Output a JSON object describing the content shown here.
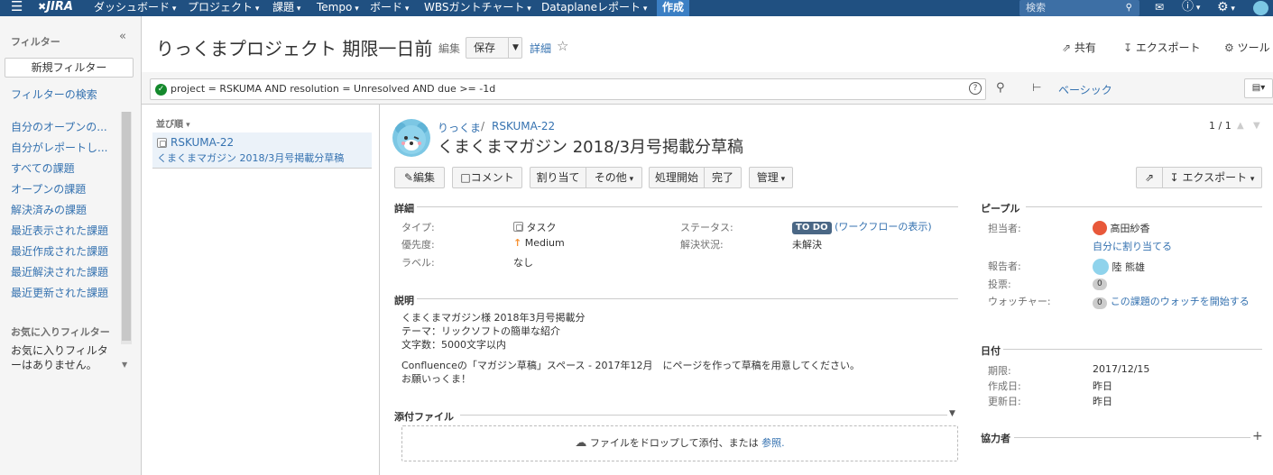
{
  "topbar": {
    "logo": "JIRA",
    "nav": [
      "ダッシュボード",
      "プロジェクト",
      "課題",
      "Tempo",
      "ボード",
      "WBSガントチャート",
      "Dataplaneレポート"
    ],
    "create_label": "作成",
    "search_placeholder": "検索"
  },
  "sidebar": {
    "heading": "フィルター",
    "new_filter_label": "新規フィルター",
    "search_filters_link": "フィルターの検索",
    "links": [
      "自分のオープンの...",
      "自分がレポートし...",
      "すべての課題",
      "オープンの課題",
      "解決済みの課題",
      "最近表示された課題",
      "最近作成された課題",
      "最近解決された課題",
      "最近更新された課題"
    ],
    "favorites_heading": "お気に入りフィルター",
    "favorites_empty": "お気に入りフィルターはありません。"
  },
  "header": {
    "title": "りっくまプロジェクト 期限一日前",
    "edit_label": "編集",
    "save_label": "保存",
    "details_label": "詳細",
    "share_label": "共有",
    "export_label": "エクスポート",
    "tools_label": "ツール"
  },
  "search": {
    "jql": "project = RSKUMA AND resolution = Unresolved AND due >= -1d",
    "basic_label": "ベーシック"
  },
  "list": {
    "order_label": "並び順",
    "items": [
      {
        "key": "RSKUMA-22",
        "summary": "くまくまマガジン 2018/3月号掲載分草稿"
      }
    ]
  },
  "issue": {
    "breadcrumb_project": "りっくま",
    "breadcrumb_sep": "/",
    "key": "RSKUMA-22",
    "title": "くまくまマガジン 2018/3月号掲載分草稿",
    "pager": "1 / 1",
    "actions": {
      "edit": "編集",
      "comment": "コメント",
      "assign": "割り当て",
      "more": "その他",
      "start": "処理開始",
      "done": "完了",
      "admin": "管理",
      "export": "エクスポート"
    },
    "details": {
      "heading": "詳細",
      "type_label": "タイプ:",
      "type_value": "タスク",
      "priority_label": "優先度:",
      "priority_value": "Medium",
      "labels_label": "ラベル:",
      "labels_value": "なし",
      "status_label": "ステータス:",
      "status_value": "TO DO",
      "workflow_link": "(ワークフローの表示)",
      "resolution_label": "解決状況:",
      "resolution_value": "未解決"
    },
    "description": {
      "heading": "説明",
      "lines": [
        "くまくまマガジン様 2018年3月号掲載分",
        "テーマ：リックソフトの簡単な紹介",
        "文字数：5000文字以内"
      ],
      "confluence_line": "Confluenceの「マガジン草稿」スペース - 2017年12月　にページを作って草稿を用意してください。",
      "closing_line": "お願いっくま！"
    },
    "attachments": {
      "heading": "添付ファイル",
      "drop_text": "ファイルをドロップして添付、または",
      "browse_link": "参照."
    },
    "people": {
      "heading": "ピープル",
      "assignee_label": "担当者:",
      "assignee_value": "高田紗香",
      "assign_to_me": "自分に割り当てる",
      "reporter_label": "報告者:",
      "reporter_value": "陸 熊雄",
      "votes_label": "投票:",
      "votes_value": "0",
      "watchers_label": "ウォッチャー:",
      "watchers_value": "0",
      "watch_link": "この課題のウォッチを開始する"
    },
    "dates": {
      "heading": "日付",
      "due_label": "期限:",
      "due_value": "2017/12/15",
      "created_label": "作成日:",
      "created_value": "昨日",
      "updated_label": "更新日:",
      "updated_value": "昨日"
    },
    "collaborators": {
      "heading": "協力者",
      "add": "+"
    }
  }
}
